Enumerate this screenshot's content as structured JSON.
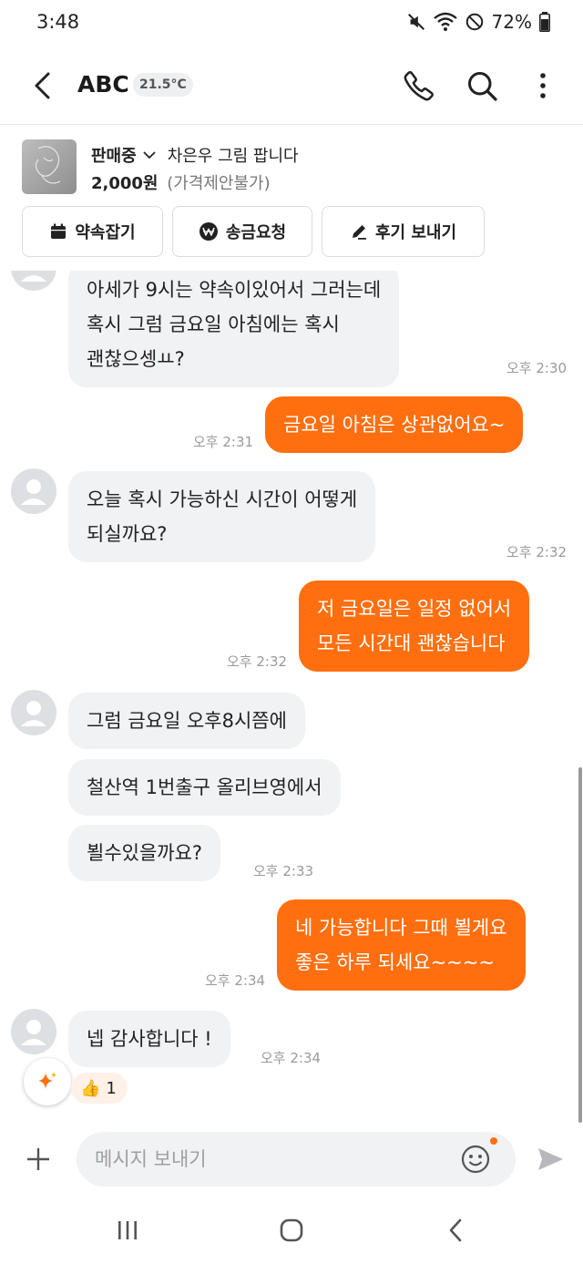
{
  "status_bar": {
    "time": "3:48",
    "battery": "72%"
  },
  "header": {
    "title": "ABC",
    "temperature": "21.5°C"
  },
  "product": {
    "status": "판매중",
    "title": "차은우 그림 팝니다",
    "price": "2,000원",
    "price_note": "(가격제안불가)",
    "actions": [
      {
        "label": "약속잡기",
        "icon": "calendar-icon"
      },
      {
        "label": "송금요청",
        "icon": "won-icon"
      },
      {
        "label": "후기 보내기",
        "icon": "pencil-icon"
      }
    ]
  },
  "messages": [
    {
      "side": "in",
      "text": "아세가 9시는 약속이있어서 그러는데\n혹시 그럼 금요일 아침에는 혹시\n괜찮으셍ㅛ?",
      "time": "오후 2:30"
    },
    {
      "side": "out",
      "text": "금요일 아침은 상관없어요~",
      "time": "오후 2:31"
    },
    {
      "side": "in",
      "text": "오늘 혹시 가능하신 시간이 어떻게\n되실까요?",
      "time": "오후 2:32"
    },
    {
      "side": "out",
      "text": "저 금요일은 일정 없어서\n모든 시간대 괜찮습니다",
      "time": "오후 2:32"
    },
    {
      "side": "in",
      "text": "그럼 금요일 오후8시쯤에",
      "time": ""
    },
    {
      "side": "in",
      "text": "철산역 1번출구 올리브영에서",
      "time": ""
    },
    {
      "side": "in",
      "text": "뵐수있을까요?",
      "time": "오후 2:33"
    },
    {
      "side": "out",
      "text": "네 가능합니다 그때 뵐게요\n좋은 하루 되세요~~~~",
      "time": "오후 2:34"
    },
    {
      "side": "in",
      "text": "넵 감사합니다 !",
      "time": "오후 2:34"
    }
  ],
  "reaction": {
    "emoji": "👍",
    "count": "1"
  },
  "input": {
    "placeholder": "메시지 보내기"
  },
  "colors": {
    "accent": "#ff6f0f",
    "incoming_bubble": "#f1f2f4"
  }
}
